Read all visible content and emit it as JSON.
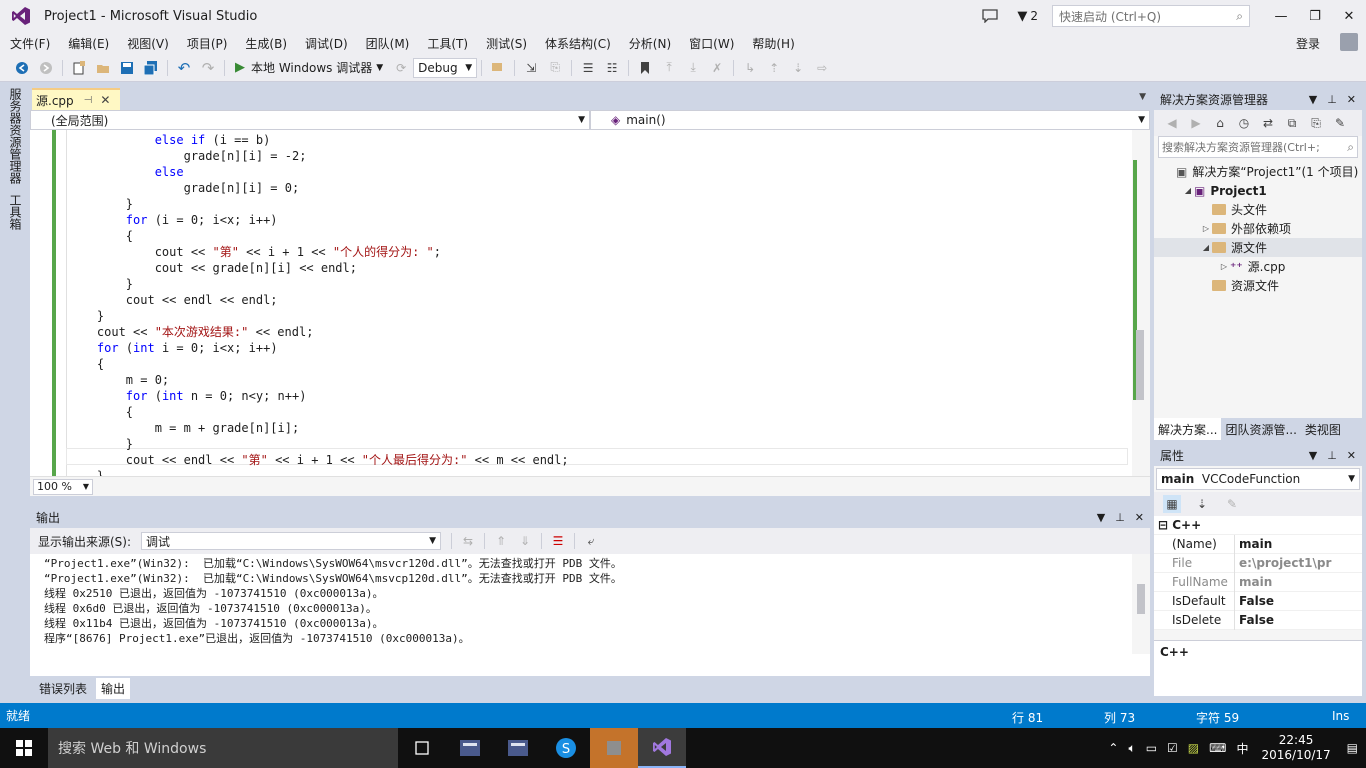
{
  "window": {
    "title": "Project1 - Microsoft Visual Studio",
    "notification_count": "2",
    "quick_launch_placeholder": "快速启动 (Ctrl+Q)"
  },
  "menu": [
    "文件(F)",
    "编辑(E)",
    "视图(V)",
    "项目(P)",
    "生成(B)",
    "调试(D)",
    "团队(M)",
    "工具(T)",
    "测试(S)",
    "体系结构(C)",
    "分析(N)",
    "窗口(W)",
    "帮助(H)"
  ],
  "login": "登录",
  "toolbar": {
    "run_label": "本地 Windows 调试器",
    "config": "Debug"
  },
  "left_tabs": [
    "服务器资源管理器",
    "工具箱"
  ],
  "editor": {
    "tab_name": "源.cpp",
    "scope": "(全局范围)",
    "function": "main()",
    "zoom": "100 %",
    "code_lines": [
      [
        {
          "t": "            "
        },
        {
          "t": "else if",
          "c": "kw"
        },
        {
          "t": " (i == b)"
        }
      ],
      [
        {
          "t": "                grade[n][i] = -2;"
        }
      ],
      [
        {
          "t": "            "
        },
        {
          "t": "else",
          "c": "kw"
        }
      ],
      [
        {
          "t": "                grade[n][i] = 0;"
        }
      ],
      [
        {
          "t": "        }"
        }
      ],
      [
        {
          "t": "        "
        },
        {
          "t": "for",
          "c": "kw"
        },
        {
          "t": " (i = 0; i<x; i++)"
        }
      ],
      [
        {
          "t": "        {"
        }
      ],
      [
        {
          "t": "            cout << "
        },
        {
          "t": "\"第\"",
          "c": "str"
        },
        {
          "t": " << i + 1 << "
        },
        {
          "t": "\"个人的得分为: \"",
          "c": "str"
        },
        {
          "t": ";"
        }
      ],
      [
        {
          "t": "            cout << grade[n][i] << endl;"
        }
      ],
      [
        {
          "t": "        }"
        }
      ],
      [
        {
          "t": "        cout << endl << endl;"
        }
      ],
      [
        {
          "t": "    }"
        }
      ],
      [
        {
          "t": "    cout << "
        },
        {
          "t": "\"本次游戏结果:\"",
          "c": "str"
        },
        {
          "t": " << endl;"
        }
      ],
      [
        {
          "t": "    "
        },
        {
          "t": "for",
          "c": "kw"
        },
        {
          "t": " ("
        },
        {
          "t": "int",
          "c": "kw"
        },
        {
          "t": " i = 0; i<x; i++)"
        }
      ],
      [
        {
          "t": "    {"
        }
      ],
      [
        {
          "t": "        m = 0;"
        }
      ],
      [
        {
          "t": "        "
        },
        {
          "t": "for",
          "c": "kw"
        },
        {
          "t": " ("
        },
        {
          "t": "int",
          "c": "kw"
        },
        {
          "t": " n = 0; n<y; n++)"
        }
      ],
      [
        {
          "t": "        {"
        }
      ],
      [
        {
          "t": "            m = m + grade[n][i];"
        }
      ],
      [
        {
          "t": "        }"
        }
      ],
      [
        {
          "t": "        cout << endl << "
        },
        {
          "t": "\"第\"",
          "c": "str"
        },
        {
          "t": " << i + 1 << "
        },
        {
          "t": "\"个人最后得分为:\"",
          "c": "str"
        },
        {
          "t": " << m << endl;"
        }
      ],
      [
        {
          "t": "    }"
        }
      ]
    ]
  },
  "output": {
    "title": "输出",
    "source_label": "显示输出来源(S):",
    "source_value": "调试",
    "lines": [
      "“Project1.exe”(Win32):  已加载“C:\\Windows\\SysWOW64\\msvcr120d.dll”。无法查找或打开 PDB 文件。",
      "“Project1.exe”(Win32):  已加载“C:\\Windows\\SysWOW64\\msvcp120d.dll”。无法查找或打开 PDB 文件。",
      "线程 0x2510 已退出，返回值为 -1073741510 (0xc000013a)。",
      "线程 0x6d0 已退出，返回值为 -1073741510 (0xc000013a)。",
      "线程 0x11b4 已退出，返回值为 -1073741510 (0xc000013a)。",
      "程序“[8676] Project1.exe”已退出，返回值为 -1073741510 (0xc000013a)。"
    ]
  },
  "bottom_tabs": [
    "错误列表",
    "输出"
  ],
  "solution_explorer": {
    "title": "解决方案资源管理器",
    "search_placeholder": "搜索解决方案资源管理器(Ctrl+;",
    "tree": [
      {
        "label": "解决方案“Project1”(1 个项目)",
        "indent": 0,
        "expander": "",
        "icon": "solution-icon"
      },
      {
        "label": "Project1",
        "indent": 1,
        "expander": "◢",
        "icon": "project-icon",
        "bold": true
      },
      {
        "label": "头文件",
        "indent": 2,
        "expander": "",
        "icon": "folder-icon"
      },
      {
        "label": "外部依赖项",
        "indent": 2,
        "expander": "▷",
        "icon": "folder-icon"
      },
      {
        "label": "源文件",
        "indent": 2,
        "expander": "◢",
        "icon": "folder-icon",
        "selected": true
      },
      {
        "label": "源.cpp",
        "indent": 3,
        "expander": "▷",
        "icon": "cpp-file-icon"
      },
      {
        "label": "资源文件",
        "indent": 2,
        "expander": "",
        "icon": "folder-icon"
      }
    ],
    "tabs": [
      "解决方案...",
      "团队资源管...",
      "类视图"
    ]
  },
  "properties": {
    "title": "属性",
    "object_name": "main",
    "object_type": "VCCodeFunction",
    "category": "C++",
    "rows": [
      {
        "key": "(Name)",
        "value": "main",
        "dim": false
      },
      {
        "key": "File",
        "value": "e:\\project1\\pr",
        "dim": true
      },
      {
        "key": "FullName",
        "value": "main",
        "dim": true
      },
      {
        "key": "IsDefault",
        "value": "False",
        "dim": false
      },
      {
        "key": "IsDelete",
        "value": "False",
        "dim": false
      }
    ],
    "description": "C++"
  },
  "status": {
    "ready": "就绪",
    "line": "行 81",
    "col": "列 73",
    "char": "字符 59",
    "mode": "Ins"
  },
  "taskbar": {
    "search": "搜索 Web 和 Windows",
    "ime": "中",
    "time": "22:45",
    "date": "2016/10/17"
  },
  "colors": {
    "status_bar": "#007acc",
    "accent_purple": "#68217a",
    "keyword": "#0000ff",
    "string": "#a31515"
  }
}
